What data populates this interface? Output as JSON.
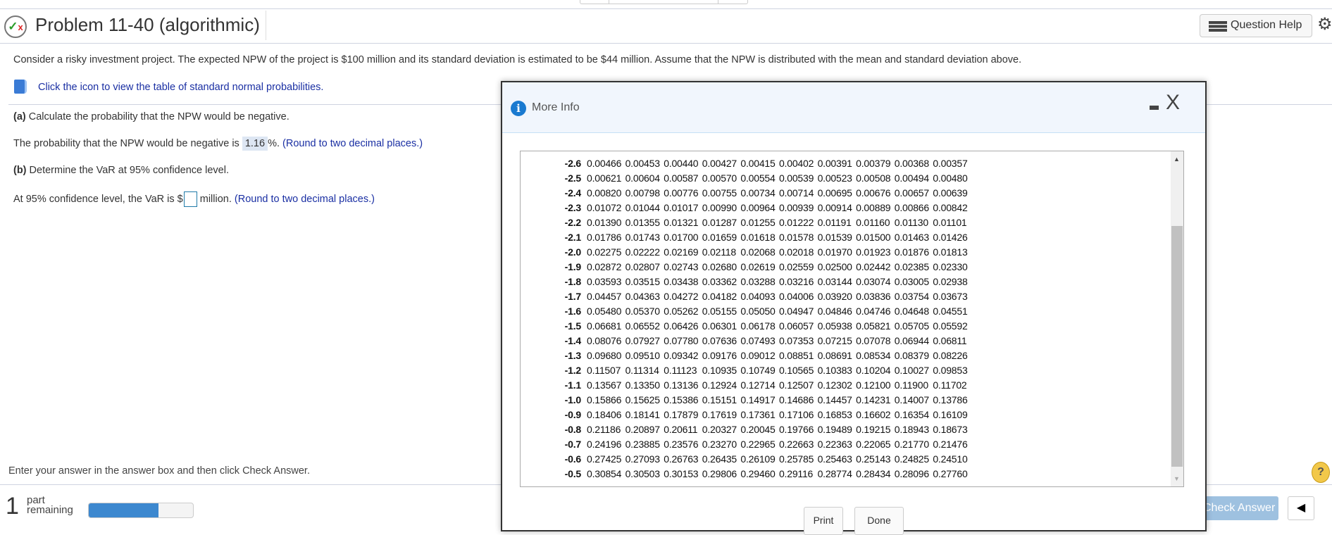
{
  "header": {
    "title": "Problem 11-40 (algorithmic)",
    "status_icon": "partial-credit-icon",
    "question_help": "Question Help"
  },
  "problem": {
    "intro": "Consider a risky investment project. The expected NPW of the project is $100 million and its standard deviation is estimated to be $44 million. Assume that the NPW is distributed with the mean and standard deviation above.",
    "table_link": "Click the icon to view the table of standard normal probabilities.",
    "a_label": "(a)",
    "a_text": " Calculate the probability that the NPW would be negative.",
    "a_answer_pre": "The probability that the NPW would be negative is ",
    "a_answer_value": "1.16",
    "a_answer_post": "%.",
    "a_hint": "(Round to two decimal places.)",
    "b_label": "(b)",
    "b_text": " Determine the VaR at 95% confidence level.",
    "b_answer_pre": "At 95% confidence level, the VaR is $",
    "b_answer_value": "",
    "b_answer_post": "million.",
    "b_hint": "(Round to two decimal places.)"
  },
  "footer": {
    "instruction": "Enter your answer in the answer box and then click Check Answer.",
    "parts_count": "1",
    "parts_label_1": "part",
    "parts_label_2": "remaining",
    "progress": 0.67,
    "check_answer": "Check Answer"
  },
  "dialog": {
    "title": "More Info",
    "print": "Print",
    "done": "Done",
    "rows": [
      [
        "-2.6",
        "0.00466",
        "0.00453",
        "0.00440",
        "0.00427",
        "0.00415",
        "0.00402",
        "0.00391",
        "0.00379",
        "0.00368",
        "0.00357"
      ],
      [
        "-2.5",
        "0.00621",
        "0.00604",
        "0.00587",
        "0.00570",
        "0.00554",
        "0.00539",
        "0.00523",
        "0.00508",
        "0.00494",
        "0.00480"
      ],
      [
        "-2.4",
        "0.00820",
        "0.00798",
        "0.00776",
        "0.00755",
        "0.00734",
        "0.00714",
        "0.00695",
        "0.00676",
        "0.00657",
        "0.00639"
      ],
      [
        "-2.3",
        "0.01072",
        "0.01044",
        "0.01017",
        "0.00990",
        "0.00964",
        "0.00939",
        "0.00914",
        "0.00889",
        "0.00866",
        "0.00842"
      ],
      [
        "-2.2",
        "0.01390",
        "0.01355",
        "0.01321",
        "0.01287",
        "0.01255",
        "0.01222",
        "0.01191",
        "0.01160",
        "0.01130",
        "0.01101"
      ],
      [
        "-2.1",
        "0.01786",
        "0.01743",
        "0.01700",
        "0.01659",
        "0.01618",
        "0.01578",
        "0.01539",
        "0.01500",
        "0.01463",
        "0.01426"
      ],
      [
        "-2.0",
        "0.02275",
        "0.02222",
        "0.02169",
        "0.02118",
        "0.02068",
        "0.02018",
        "0.01970",
        "0.01923",
        "0.01876",
        "0.01813"
      ],
      [
        "-1.9",
        "0.02872",
        "0.02807",
        "0.02743",
        "0.02680",
        "0.02619",
        "0.02559",
        "0.02500",
        "0.02442",
        "0.02385",
        "0.02330"
      ],
      [
        "-1.8",
        "0.03593",
        "0.03515",
        "0.03438",
        "0.03362",
        "0.03288",
        "0.03216",
        "0.03144",
        "0.03074",
        "0.03005",
        "0.02938"
      ],
      [
        "-1.7",
        "0.04457",
        "0.04363",
        "0.04272",
        "0.04182",
        "0.04093",
        "0.04006",
        "0.03920",
        "0.03836",
        "0.03754",
        "0.03673"
      ],
      [
        "-1.6",
        "0.05480",
        "0.05370",
        "0.05262",
        "0.05155",
        "0.05050",
        "0.04947",
        "0.04846",
        "0.04746",
        "0.04648",
        "0.04551"
      ],
      [
        "-1.5",
        "0.06681",
        "0.06552",
        "0.06426",
        "0.06301",
        "0.06178",
        "0.06057",
        "0.05938",
        "0.05821",
        "0.05705",
        "0.05592"
      ],
      [
        "-1.4",
        "0.08076",
        "0.07927",
        "0.07780",
        "0.07636",
        "0.07493",
        "0.07353",
        "0.07215",
        "0.07078",
        "0.06944",
        "0.06811"
      ],
      [
        "-1.3",
        "0.09680",
        "0.09510",
        "0.09342",
        "0.09176",
        "0.09012",
        "0.08851",
        "0.08691",
        "0.08534",
        "0.08379",
        "0.08226"
      ],
      [
        "-1.2",
        "0.11507",
        "0.11314",
        "0.11123",
        "0.10935",
        "0.10749",
        "0.10565",
        "0.10383",
        "0.10204",
        "0.10027",
        "0.09853"
      ],
      [
        "-1.1",
        "0.13567",
        "0.13350",
        "0.13136",
        "0.12924",
        "0.12714",
        "0.12507",
        "0.12302",
        "0.12100",
        "0.11900",
        "0.11702"
      ],
      [
        "-1.0",
        "0.15866",
        "0.15625",
        "0.15386",
        "0.15151",
        "0.14917",
        "0.14686",
        "0.14457",
        "0.14231",
        "0.14007",
        "0.13786"
      ],
      [
        "-0.9",
        "0.18406",
        "0.18141",
        "0.17879",
        "0.17619",
        "0.17361",
        "0.17106",
        "0.16853",
        "0.16602",
        "0.16354",
        "0.16109"
      ],
      [
        "-0.8",
        "0.21186",
        "0.20897",
        "0.20611",
        "0.20327",
        "0.20045",
        "0.19766",
        "0.19489",
        "0.19215",
        "0.18943",
        "0.18673"
      ],
      [
        "-0.7",
        "0.24196",
        "0.23885",
        "0.23576",
        "0.23270",
        "0.22965",
        "0.22663",
        "0.22363",
        "0.22065",
        "0.21770",
        "0.21476"
      ],
      [
        "-0.6",
        "0.27425",
        "0.27093",
        "0.26763",
        "0.26435",
        "0.26109",
        "0.25785",
        "0.25463",
        "0.25143",
        "0.24825",
        "0.24510"
      ],
      [
        "-0.5",
        "0.30854",
        "0.30503",
        "0.30153",
        "0.29806",
        "0.29460",
        "0.29116",
        "0.28774",
        "0.28434",
        "0.28096",
        "0.27760"
      ]
    ]
  }
}
